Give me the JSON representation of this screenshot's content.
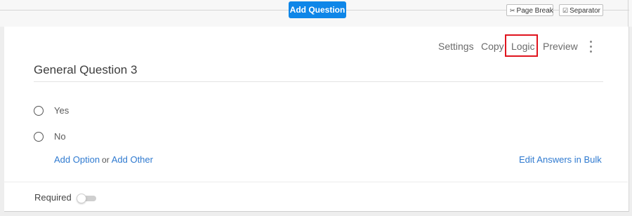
{
  "top_bar": {
    "add_question_label": "Add Question",
    "page_break_label": "Page Break",
    "separator_label": "Separator",
    "page_break_icon": "scissors-icon",
    "separator_icon": "checkbox-icon"
  },
  "toolbar": {
    "settings": "Settings",
    "copy": "Copy",
    "logic": "Logic",
    "preview": "Preview",
    "more_icon": "kebab-menu-icon",
    "highlighted_item": "Logic"
  },
  "question": {
    "title": "General Question 3",
    "options": [
      {
        "label": "Yes"
      },
      {
        "label": "No"
      }
    ],
    "add_option_label": "Add Option",
    "or_text": "or",
    "add_other_label": "Add Other",
    "edit_bulk_label": "Edit Answers in Bulk",
    "required_label": "Required",
    "required_on": false
  },
  "colors": {
    "accent": "#1a8ae6",
    "button": "#0e86e8",
    "link": "#2f7ad0",
    "highlight_box": "#e0141e"
  }
}
